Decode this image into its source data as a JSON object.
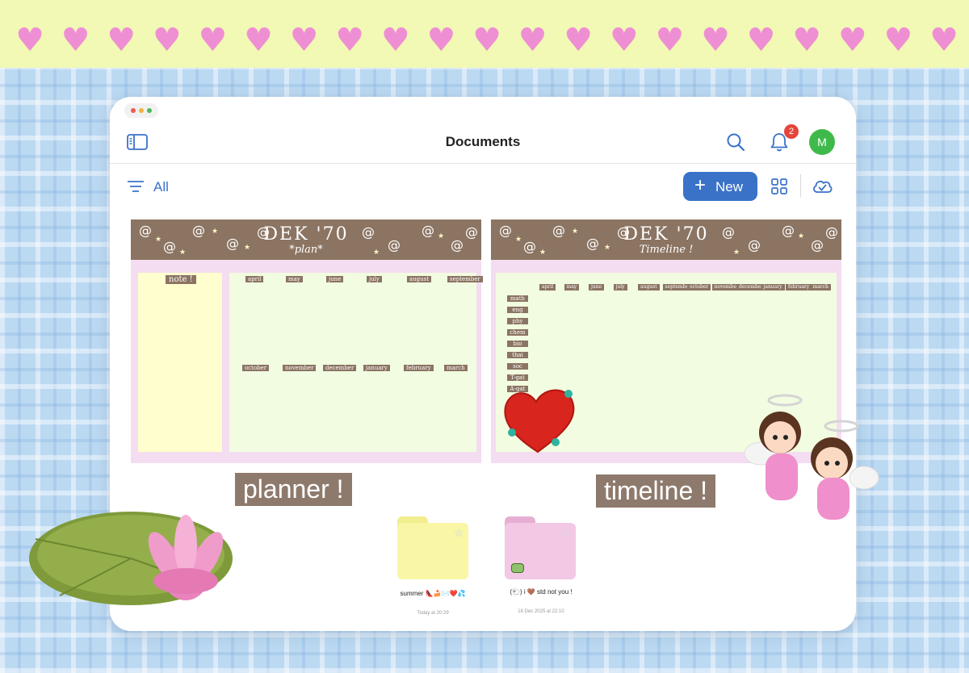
{
  "window": {
    "title": "Documents",
    "notification_count": "2",
    "avatar_initial": "M",
    "filter_label": "All",
    "new_button_label": "New"
  },
  "documents": [
    {
      "header_title": "DEK '70",
      "header_subtitle": "*plan*",
      "note_label": "note !",
      "months_top": [
        "april",
        "may",
        "june",
        "july",
        "august",
        "september"
      ],
      "months_bottom": [
        "october",
        "november",
        "december",
        "january",
        "february",
        "march"
      ],
      "caption": "planner !"
    },
    {
      "header_title": "DEK '70",
      "header_subtitle": "Timeline !",
      "months": [
        "april",
        "may",
        "june",
        "july",
        "august",
        "september",
        "october",
        "november",
        "december",
        "january",
        "february",
        "march"
      ],
      "subjects": [
        "math",
        "eng",
        "phy",
        "chem",
        "bio",
        "thai",
        "soc",
        "T-gat",
        "A-gat"
      ],
      "caption": "timeline !"
    }
  ],
  "folders": [
    {
      "name": "summer 👠🍰✉️❤️💦",
      "date": "Today at 20:29",
      "color": "#f9f6a6"
    },
    {
      "name": "(🐑) i 🤎 std not you !",
      "date": "18 Dec 2025 at 22:10",
      "color": "#f2c8e4"
    }
  ],
  "colors": {
    "accent": "#3a72c8",
    "badge": "#e5453b",
    "avatar": "#3fba4a",
    "header_brown": "#8b7462",
    "caption_brown": "#8e7a6c"
  }
}
